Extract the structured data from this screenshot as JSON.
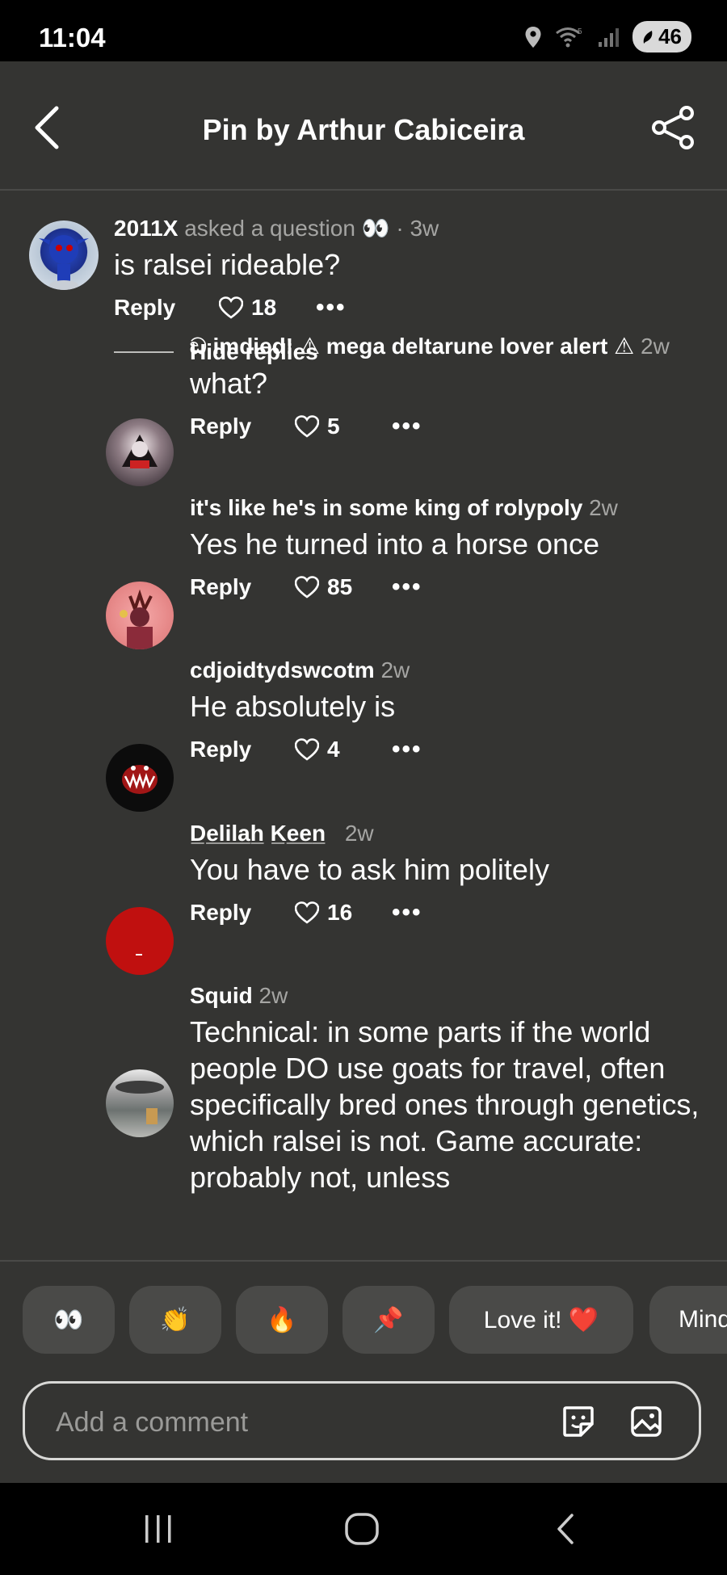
{
  "status_bar": {
    "time": "11:04",
    "battery": "46",
    "wifi_label": "5"
  },
  "header": {
    "title": "Pin by Arthur Cabiceira"
  },
  "question": {
    "user": "2011X",
    "action": "asked a question 👀",
    "time": "· 3w",
    "text": "is ralsei rideable?",
    "reply_label": "Reply",
    "likes": "18"
  },
  "hide_replies_label": "Hide replies",
  "replies": [
    {
      "user": "ඞ imdied! ⚠ mega deltarune lover alert ⚠",
      "time": "2w",
      "text": "what?",
      "reply_label": "Reply",
      "likes": "5"
    },
    {
      "user": "it's like he's in some king of rolypoly",
      "time": "2w",
      "text": "Yes he turned into a horse once",
      "reply_label": "Reply",
      "likes": "85"
    },
    {
      "user": "cdjoidtydswcotm",
      "time": "2w",
      "text": "He absolutely is",
      "reply_label": "Reply",
      "likes": "4"
    },
    {
      "user": "D̲e̲l̲i̲l̲a̲h̲ K̲e̲e̲n̲",
      "time": "2w",
      "text": "You have to ask him politely",
      "reply_label": "Reply",
      "likes": "16"
    },
    {
      "user": "Squid",
      "time": "2w",
      "text": "Technical: in some parts if the world people DO use goats for travel, often specifically bred ones through genetics, which ralsei is not. Game accurate: probably not, unless"
    }
  ],
  "reactions": [
    "👀",
    "👏",
    "🔥",
    "📌",
    "Love it! ❤️",
    "Mind"
  ],
  "comment_input": {
    "placeholder": "Add a comment"
  },
  "colors": {
    "background": "#343432",
    "chip": "#4a4a48",
    "avatar_red": "#c0100f"
  }
}
